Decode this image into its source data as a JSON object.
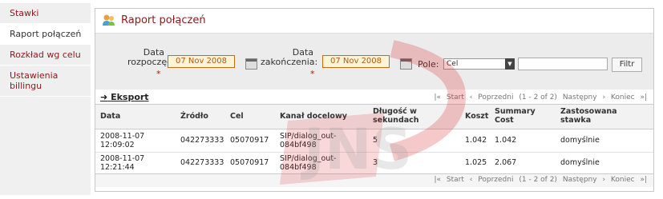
{
  "sidebar": {
    "items": [
      {
        "label": "Stawki"
      },
      {
        "label": "Raport połączeń"
      },
      {
        "label": "Rozkład wg celu"
      },
      {
        "label": "Ustawienia billingu"
      }
    ]
  },
  "panel": {
    "title": "Raport połączeń"
  },
  "filter": {
    "start_label_1": "Data",
    "start_label_2": "rozpoczęcia:",
    "start_value": "07 Nov 2008",
    "end_label_1": "Data",
    "end_label_2": "zakończenia:",
    "end_value": "07 Nov 2008",
    "required_mark": "*",
    "field_label": "Pole:",
    "field_value": "Cel",
    "filter_button": "Filtr"
  },
  "export_label": "Eksport",
  "pager": {
    "start": "Start",
    "prev": "Poprzedni",
    "info": "(1 - 2 of 2)",
    "next": "Następny",
    "end": "Koniec"
  },
  "table": {
    "headers": [
      "Data",
      "Źródło",
      "Cel",
      "Kanał docelowy",
      "Długość w sekundach",
      "Koszt",
      "Summary Cost",
      "Zastosowana stawka"
    ],
    "rows": [
      {
        "date": "2008-11-07 12:09:02",
        "source": "042273333",
        "dest": "05070917",
        "channel": "SIP/dialog_out-084bf498",
        "duration": "5",
        "cost": "1.042",
        "summary": "1.042",
        "rate": "domyślnie"
      },
      {
        "date": "2008-11-07 12:21:44",
        "source": "042273333",
        "dest": "05070917",
        "channel": "SIP/dialog_out-084bf498",
        "duration": "3",
        "cost": "1.025",
        "summary": "2.067",
        "rate": "domyślnie"
      }
    ]
  },
  "colors": {
    "accent": "#8b1a1a",
    "watermark": "#d8252a"
  }
}
